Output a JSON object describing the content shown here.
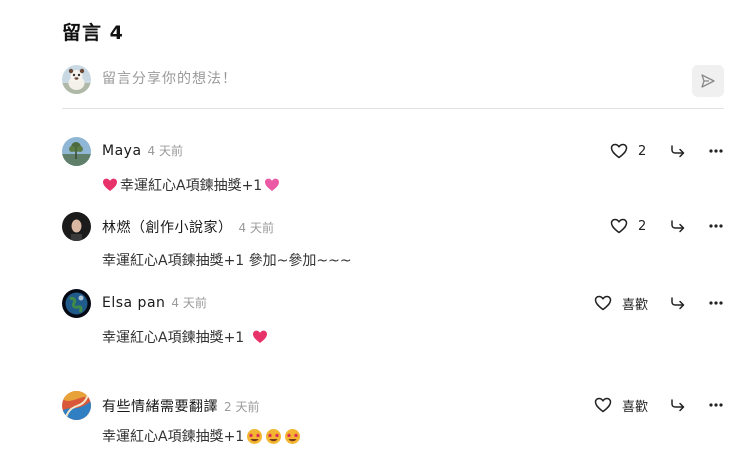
{
  "header": {
    "title": "留言 4"
  },
  "composer": {
    "placeholder": "留言分享你的想法！"
  },
  "comments": [
    {
      "name": "Maya",
      "time": "4 天前",
      "text": "幸運紅心A項鍊抽獎+1",
      "like_label": "2"
    },
    {
      "name": "林燃（創作小說家）",
      "time": "4 天前",
      "text": "幸運紅心A項鍊抽獎+1 參加~參加~~~",
      "like_label": "2"
    },
    {
      "name": "Elsa pan",
      "time": "4 天前",
      "text": "幸運紅心A項鍊抽獎+1",
      "like_label": "喜歡"
    },
    {
      "name": "有些情緒需要翻譯",
      "time": "2 天前",
      "text": "幸運紅心A項鍊抽獎+1",
      "like_label": "喜歡"
    }
  ],
  "colors": {
    "heart_emoji": "#e8326a",
    "muted_text": "#9a9a9a",
    "divider": "#e2e2e2"
  },
  "icons": [
    "heart-outline-icon",
    "reply-arrow-icon",
    "more-dots-icon",
    "send-icon",
    "pink-heart-emoji",
    "star-eyes-emoji"
  ]
}
